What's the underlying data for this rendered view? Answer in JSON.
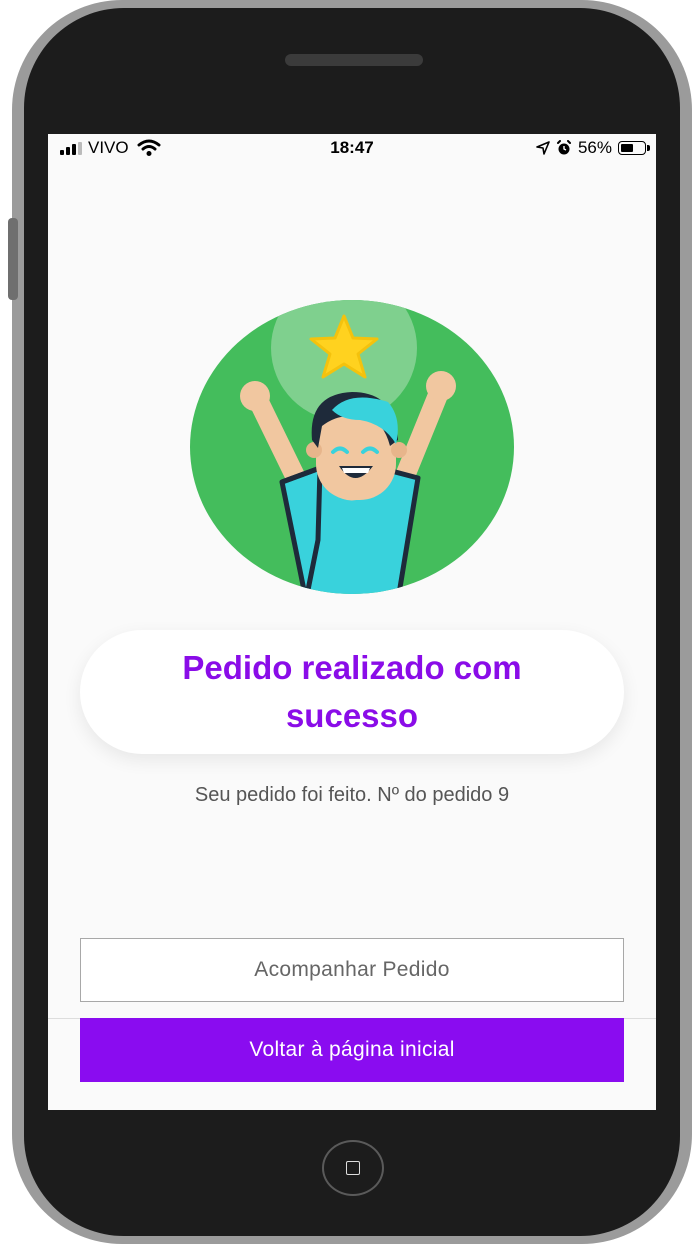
{
  "status_bar": {
    "carrier": "VIVO",
    "time": "18:47",
    "battery": "56%",
    "battery_level": 0.56,
    "icons": [
      "signal-icon",
      "wifi-icon",
      "location-icon",
      "alarm-icon",
      "battery-icon"
    ]
  },
  "content": {
    "title": "Pedido realizado com sucesso",
    "message": "Seu pedido foi feito. Nº do pedido 9",
    "illustration": "celebrating-person-with-star"
  },
  "actions": {
    "track_label": "Acompanhar Pedido",
    "home_label": "Voltar à página inicial"
  },
  "colors": {
    "accent": "#8a0cf0",
    "title": "#8a0ce8",
    "illustration_bg": "#44bd5c",
    "star": "#ffd21f",
    "shirt": "#39d2dc"
  }
}
